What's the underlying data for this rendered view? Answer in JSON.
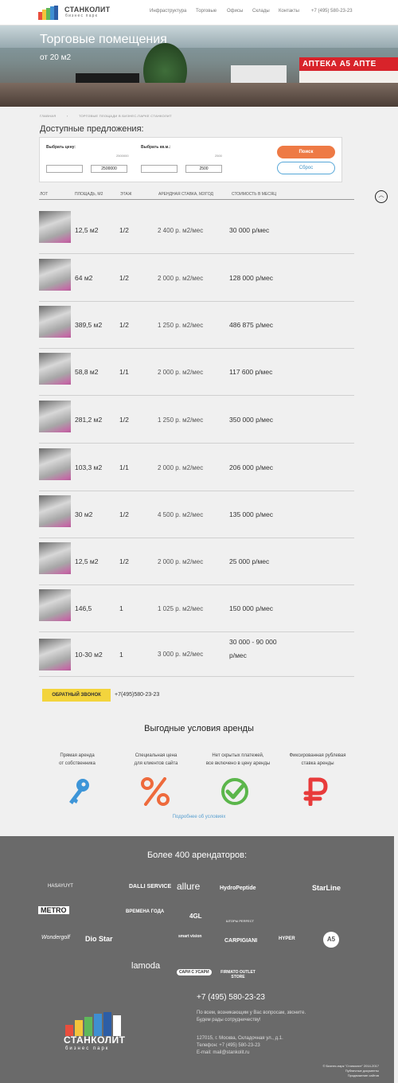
{
  "header": {
    "logo_name": "СТАНКОЛИТ",
    "logo_sub": "бизнес парк",
    "nav": [
      "Инфраструктура",
      "Торговые",
      "Офисы",
      "Склады",
      "Контакты"
    ],
    "phone": "+7 (495) 580-23-23"
  },
  "hero": {
    "title": "Торговые помещения",
    "subtitle": "от 20 м2",
    "sign_apteka": "АПТЕКА A5 АПТЕ"
  },
  "breadcrumb": [
    "ГЛАВНАЯ",
    "ТОРГОВЫЕ ПЛОЩАДИ В БИЗНЕС-ПАРКЕ СТАНКОЛИТ"
  ],
  "offers_title": "Доступные предложения:",
  "filter": {
    "price_label": "Выбрать цену:",
    "price_max": "2500000",
    "price_from": "",
    "price_to": "2500000",
    "area_label": "Выбрать кв.м.:",
    "area_max": "2500",
    "area_from": "",
    "area_to": "2500",
    "search": "Поиск",
    "reset": "Сброс"
  },
  "table": {
    "headers": [
      "ЛОТ",
      "ПЛОЩАДЬ, М2",
      "ЭТАЖ",
      "АРЕНДНАЯ СТАВКА, М2/ГОД",
      "СТОИМОСТЬ В МЕСЯЦ"
    ],
    "rows": [
      {
        "area": "12,5 м2",
        "floor": "1/2",
        "rate": "2 400 р. м2/мес",
        "cost": "30 000 р/мес"
      },
      {
        "area": "64 м2",
        "floor": "1/2",
        "rate": "2 000 р. м2/мес",
        "cost": "128 000 р/мес"
      },
      {
        "area": "389,5 м2",
        "floor": "1/2",
        "rate": "1 250 р. м2/мес",
        "cost": "486 875 р/мес"
      },
      {
        "area": "58,8 м2",
        "floor": "1/1",
        "rate": "2 000 р. м2/мес",
        "cost": "117 600 р/мес"
      },
      {
        "area": "281,2 м2",
        "floor": "1/2",
        "rate": "1 250 р. м2/мес",
        "cost": "350 000 р/мес"
      },
      {
        "area": "103,3 м2",
        "floor": "1/1",
        "rate": "2 000 р. м2/мес",
        "cost": "206 000 р/мес"
      },
      {
        "area": "30 м2",
        "floor": "1/2",
        "rate": "4 500 р. м2/мес",
        "cost": "135 000 р/мес"
      },
      {
        "area": "12,5 м2",
        "floor": "1/2",
        "rate": "2 000 р. м2/мес",
        "cost": "25 000 р/мес"
      },
      {
        "area": "146,5",
        "floor": "1",
        "rate": "1 025 р. м2/мес",
        "cost": "150 000 р/мес"
      },
      {
        "area": "10-30 м2",
        "floor": "1",
        "rate": "3 000 р. м2/мес",
        "cost": "30 000 - 90 000",
        "cost2": "р/мес"
      }
    ]
  },
  "callback": {
    "button": "ОБРАТНЫЙ ЗВОНОК",
    "phone": "+7(495)580-23-23"
  },
  "conditions": {
    "title": "Выгодные условия аренды",
    "items": [
      {
        "line1": "Прямая аренда",
        "line2": "от собственника",
        "icon": "key-icon"
      },
      {
        "line1": "Специальная цена",
        "line2": "для клиентов сайта",
        "icon": "percent-icon"
      },
      {
        "line1": "Нет скрытых платежей,",
        "line2": "все включено в цену аренды",
        "icon": "check-icon"
      },
      {
        "line1": "Фиксированная рублевая",
        "line2": "ставка аренды",
        "icon": "ruble-icon"
      }
    ],
    "more": "Подробнее об условиях"
  },
  "tenants": {
    "title": "Более 400 арендаторов:",
    "brands": [
      "HASAYUYT",
      "DALLI SERVICE",
      "allure",
      "HydroPeptide",
      "StarLine",
      "METRO",
      "ВРЕМЕНА ГОДА",
      "4GL",
      "ШТОРЫ PERFECT",
      "Wondergolf",
      "Dio Star",
      "smart vision",
      "CARPIGIANI",
      "HYPER",
      "A5",
      "lamoda",
      "САРИ С УСАРИ",
      "FIRMATO OUTLET STORE"
    ]
  },
  "footer": {
    "logo_name": "СТАНКОЛИТ",
    "logo_sub": "бизнес парк",
    "phone": "+7 (495) 580-23-23",
    "text1": "По всем, возникающим у Вас вопросам, звоните.",
    "text2": "Будем рады сотрудничеству!",
    "addr1": "127015, г. Москва, Складочная ул., д.1.",
    "addr2": "Телефон: +7 (495) 580-23-23",
    "addr3": "E-mail: mail@stankolit.ru",
    "copy1": "© Бизнес-парк \"Станколит\" 2014-2017",
    "copy2": "Публичные документы",
    "copy3": "Продвижение сайтов"
  },
  "colors": {
    "accent": "#ee7a45",
    "callback": "#f3d43d",
    "link": "#5aa0d0",
    "footer_bg": "#6a6a6a"
  }
}
